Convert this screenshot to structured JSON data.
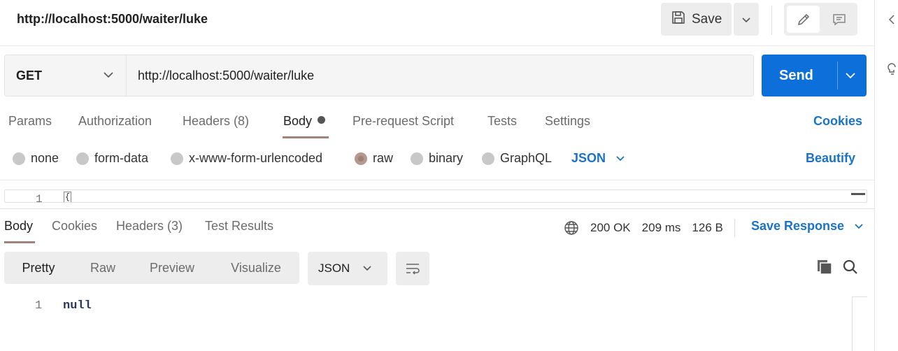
{
  "header": {
    "request_title": "http://localhost:5000/waiter/luke",
    "save_label": "Save"
  },
  "request": {
    "method": "GET",
    "url": "http://localhost:5000/waiter/luke",
    "send_label": "Send"
  },
  "request_tabs": {
    "params": "Params",
    "authorization": "Authorization",
    "headers": "Headers (8)",
    "body": "Body",
    "prerequest": "Pre-request Script",
    "tests": "Tests",
    "settings": "Settings",
    "cookies": "Cookies"
  },
  "body_types": {
    "none": "none",
    "form_data": "form-data",
    "urlencoded": "x-www-form-urlencoded",
    "raw": "raw",
    "binary": "binary",
    "graphql": "GraphQL",
    "selected": "raw",
    "language": "JSON",
    "beautify": "Beautify"
  },
  "editor": {
    "line_number": "1",
    "code": "{"
  },
  "response_tabs": {
    "body": "Body",
    "cookies": "Cookies",
    "headers": "Headers (3)",
    "test_results": "Test Results"
  },
  "response_status": {
    "status": "200 OK",
    "time": "209 ms",
    "size": "126 B",
    "save_response": "Save Response"
  },
  "response_view": {
    "pretty": "Pretty",
    "raw": "Raw",
    "preview": "Preview",
    "visualize": "Visualize",
    "format": "JSON"
  },
  "response_body": {
    "line_number": "1",
    "code": "null"
  },
  "colors": {
    "accent_blue": "#0d6fd9",
    "link_blue": "#1a73c9",
    "active_underline": "#a0847c"
  }
}
